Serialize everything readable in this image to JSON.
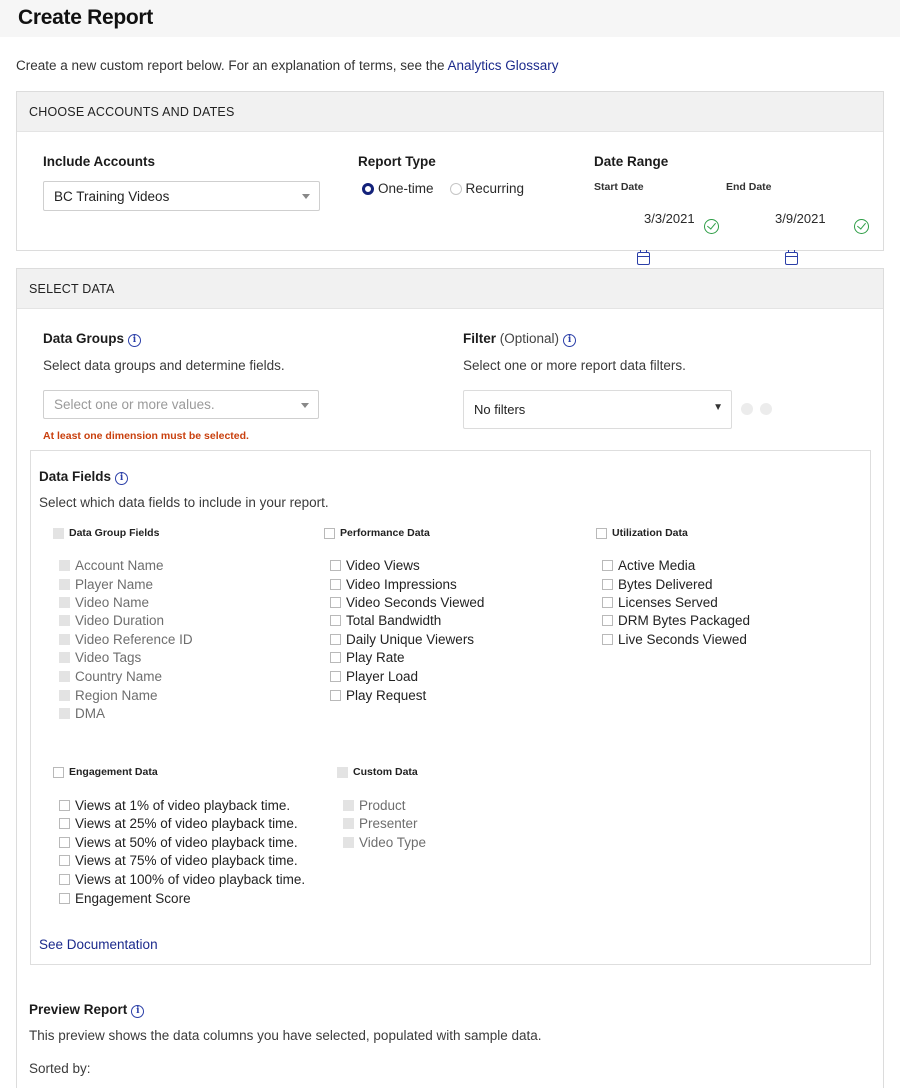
{
  "page": {
    "title": "Create Report",
    "intro_text": "Create a new custom report below. For an explanation of terms, see the ",
    "glossary_link": "Analytics Glossary"
  },
  "accounts_panel": {
    "header": "CHOOSE ACCOUNTS AND DATES",
    "include_accounts_label": "Include Accounts",
    "account_value": "BC Training Videos",
    "report_type_label": "Report Type",
    "report_type_options": [
      "One-time",
      "Recurring"
    ],
    "report_type_selected": "One-time",
    "date_range_label": "Date Range",
    "start_date_label": "Start Date",
    "start_date_value": "3/3/2021",
    "end_date_label": "End Date",
    "end_date_value": "3/9/2021"
  },
  "data_panel": {
    "header": "SELECT DATA",
    "data_groups_label": "Data Groups",
    "data_groups_desc": "Select data groups and determine fields.",
    "data_groups_placeholder": "Select one or more values.",
    "data_groups_error": "At least one dimension must be selected.",
    "filter_label": "Filter",
    "filter_optional": "(Optional)",
    "filter_desc": "Select one or more report data filters.",
    "filter_value": "No filters",
    "filter_caret": "▼",
    "data_fields": {
      "title": "Data Fields",
      "desc": "Select which data fields to include in your report.",
      "group_fields": {
        "title": "Data Group Fields",
        "items": [
          "Account Name",
          "Player Name",
          "Video Name",
          "Video Duration",
          "Video Reference ID",
          "Video Tags",
          "Country Name",
          "Region Name",
          "DMA"
        ]
      },
      "performance": {
        "title": "Performance Data",
        "items": [
          "Video Views",
          "Video Impressions",
          "Video Seconds Viewed",
          "Total Bandwidth",
          "Daily Unique Viewers",
          "Play Rate",
          "Player Load",
          "Play Request"
        ]
      },
      "utilization": {
        "title": "Utilization Data",
        "items": [
          "Active Media",
          "Bytes Delivered",
          "Licenses Served",
          "DRM Bytes Packaged",
          "Live Seconds Viewed"
        ]
      },
      "engagement": {
        "title": "Engagement Data",
        "items": [
          "Views at 1% of video playback time.",
          "Views at 25% of video playback time.",
          "Views at 50% of video playback time.",
          "Views at 75% of video playback time.",
          "Views at 100% of video playback time.",
          "Engagement Score"
        ]
      },
      "custom": {
        "title": "Custom Data",
        "items": [
          "Product",
          "Presenter",
          "Video Type"
        ]
      },
      "doc_link": "See Documentation"
    }
  },
  "preview": {
    "title": "Preview Report",
    "desc": "This preview shows the data columns you have selected, populated with sample data.",
    "sorted_by": "Sorted by:"
  }
}
